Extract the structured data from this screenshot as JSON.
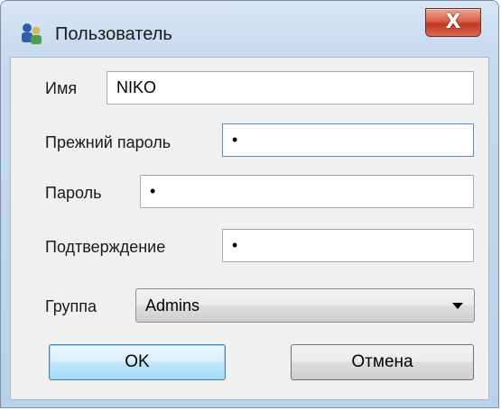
{
  "window": {
    "title": "Пользователь",
    "close_label": "X"
  },
  "form": {
    "name_label": "Имя",
    "name_value": "NIKO",
    "old_password_label": "Прежний пароль",
    "old_password_value": "•",
    "password_label": "Пароль",
    "password_value": "•",
    "confirm_label": "Подтверждение",
    "confirm_value": "•",
    "group_label": "Группа",
    "group_value": "Admins"
  },
  "buttons": {
    "ok_label": "OK",
    "cancel_label": "Отмена"
  },
  "colors": {
    "frame": "#b9d1ea",
    "client": "#f0f0f0",
    "close_button": "#c03a22",
    "default_button_border": "#3c7fb1"
  },
  "icons": {
    "app": "users-icon",
    "close": "close-icon",
    "dropdown": "chevron-down-icon"
  }
}
